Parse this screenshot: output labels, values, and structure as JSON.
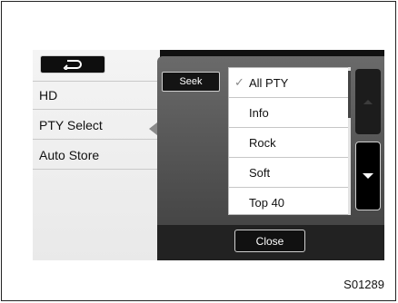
{
  "menu": {
    "items": [
      {
        "label": "HD"
      },
      {
        "label": "PTY Select"
      },
      {
        "label": "Auto Store"
      }
    ]
  },
  "popup": {
    "seek_label": "Seek",
    "list": [
      {
        "label": "All PTY",
        "checked": true
      },
      {
        "label": "Info",
        "checked": false
      },
      {
        "label": "Rock",
        "checked": false
      },
      {
        "label": "Soft",
        "checked": false
      },
      {
        "label": "Top 40",
        "checked": false
      }
    ],
    "close_label": "Close"
  },
  "icons": {
    "back": "back-arrow-icon",
    "check": "checkmark-icon",
    "scroll_up": "chevron-up-icon",
    "scroll_down": "chevron-down-icon",
    "selector": "pointer-left-icon"
  },
  "figure_code": "S01289"
}
